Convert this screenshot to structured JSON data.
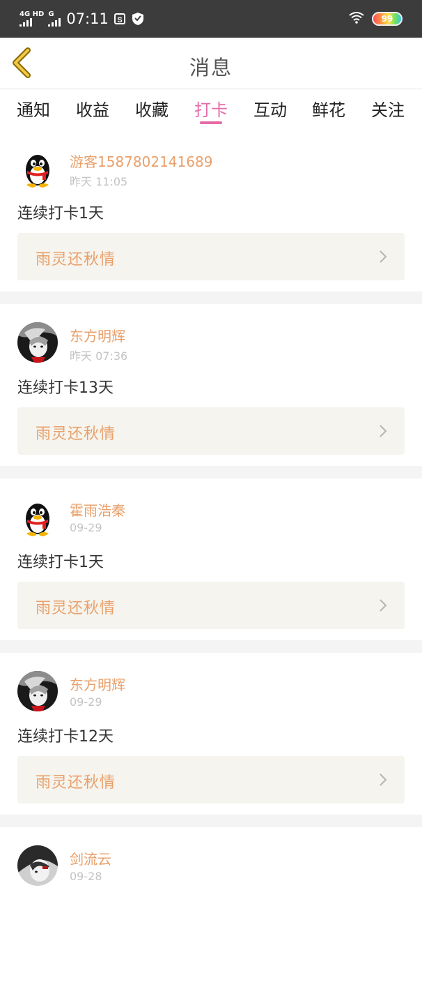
{
  "status_bar": {
    "sim1_label": "4G HD",
    "sim2_label": "G",
    "time": "07:11",
    "battery": "99",
    "icons": [
      "signal-icon",
      "signal-icon",
      "screenshot-icon",
      "shield-icon",
      "wifi-icon",
      "battery-icon"
    ]
  },
  "header": {
    "back_icon": "chevron-left-icon",
    "title": "消息"
  },
  "tabs": [
    {
      "label": "通知"
    },
    {
      "label": "收益"
    },
    {
      "label": "收藏"
    },
    {
      "label": "打卡",
      "active": true
    },
    {
      "label": "互动"
    },
    {
      "label": "鲜花"
    },
    {
      "label": "关注"
    }
  ],
  "colors": {
    "accent_pink": "#e56aa7",
    "name_orange": "#e9a06b",
    "card_bg": "#f5f4ee",
    "status_bg": "#3c3c3c"
  },
  "items": [
    {
      "avatar": "qq-penguin-avatar",
      "username": "游客1587802141689",
      "time": "昨天 11:05",
      "message": "连续打卡1天",
      "book_title": "雨灵还秋情"
    },
    {
      "avatar": "anime-avatar",
      "username": "东方明辉",
      "time": "昨天 07:36",
      "message": "连续打卡13天",
      "book_title": "雨灵还秋情"
    },
    {
      "avatar": "qq-penguin-avatar",
      "username": "霍雨浩秦",
      "time": "09-29",
      "message": "连续打卡1天",
      "book_title": "雨灵还秋情"
    },
    {
      "avatar": "anime-avatar",
      "username": "东方明辉",
      "time": "09-29",
      "message": "连续打卡12天",
      "book_title": "雨灵还秋情"
    },
    {
      "avatar": "anime-avatar-2",
      "username": "剑流云",
      "time": "09-28"
    }
  ]
}
